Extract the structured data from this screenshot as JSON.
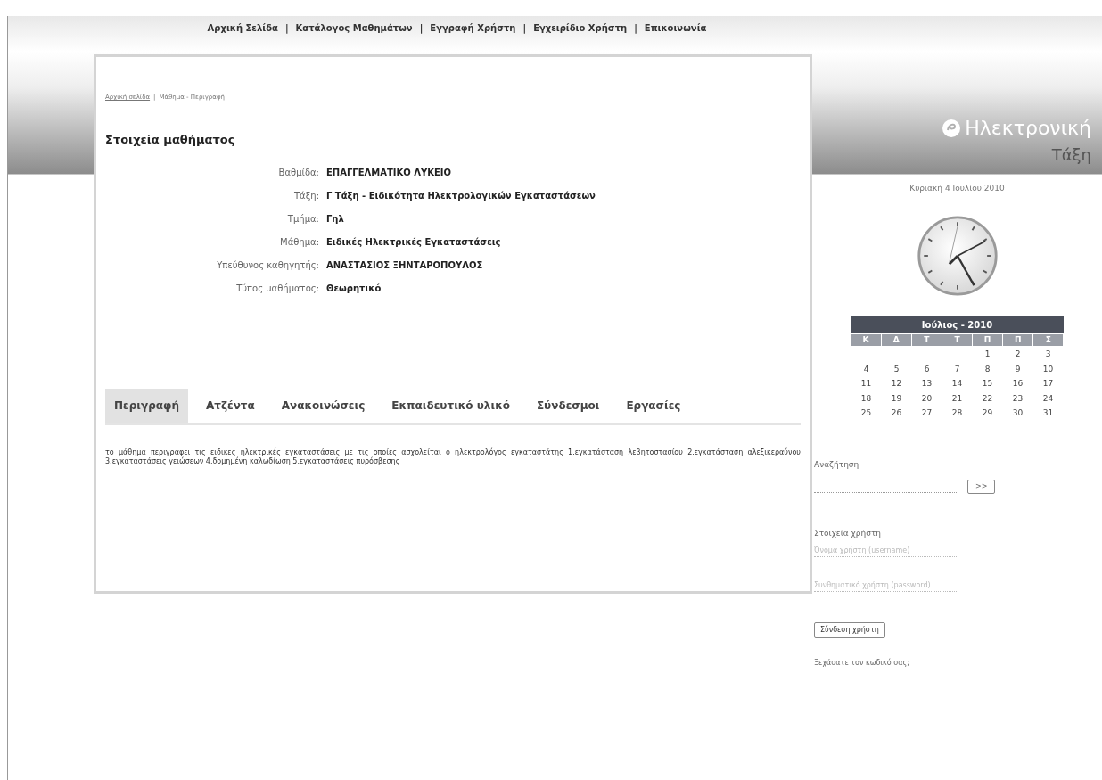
{
  "nav": [
    "Αρχική Σελίδα",
    "Κατάλογος Μαθημάτων",
    "Εγγραφή Χρήστη",
    "Εγχειρίδιο Χρήστη",
    "Επικοινωνία"
  ],
  "nav_separator": "|",
  "breadcrumb": {
    "link": "Αρχική σελίδα",
    "separator": "|",
    "current": "Μάθημα - Περιγραφή"
  },
  "course": {
    "title": "Στοιχεία μαθήματος",
    "fields": [
      {
        "label": "Βαθμίδα:",
        "value": "ΕΠΑΓΓΕΛΜΑΤΙΚΟ ΛΥΚΕΙΟ"
      },
      {
        "label": "Τάξη:",
        "value": "Γ Τάξη - Ειδικότητα Ηλεκτρολογικών Εγκαταστάσεων"
      },
      {
        "label": "Τμήμα:",
        "value": "Γηλ"
      },
      {
        "label": "Μάθημα:",
        "value": "Ειδικές Ηλεκτρικές Εγκαταστάσεις"
      },
      {
        "label": "Υπεύθυνος καθηγητής:",
        "value": "ΑΝΑΣΤΑΣΙΟΣ ΞΗΝΤΑΡΟΠΟΥΛΟΣ"
      },
      {
        "label": "Τύπος μαθήματος:",
        "value": "Θεωρητικό"
      }
    ]
  },
  "tabs": [
    {
      "label": "Περιγραφή",
      "selected": true
    },
    {
      "label": "Ατζέντα",
      "selected": false
    },
    {
      "label": "Ανακοινώσεις",
      "selected": false
    },
    {
      "label": "Εκπαιδευτικό υλικό",
      "selected": false
    },
    {
      "label": "Σύνδεσμοι",
      "selected": false
    },
    {
      "label": "Εργασίες",
      "selected": false
    }
  ],
  "description": "το μάθημα περιγραφει τις ειδικες ηλεκτρικές εγκαταστάσεις με τις οποίες ασχολείται ο ηλεκτρολόγος εγκαταστάτης 1.εγκατάσταση λεβητοστασίου 2.εγκατάσταση αλεξικεραύνου 3.εγκαταστάσεις γειώσεων 4.δομημένη καλωδίωση 5.εγκαταστάσεις πυρόσβεσης",
  "logo": {
    "line1": "Ηλεκτρονική",
    "line2": "Τάξη"
  },
  "date": "Κυριακή 4 Ιουλίου 2010",
  "calendar": {
    "title": "Ιούλιος - 2010",
    "weekdays": [
      "Κ",
      "Δ",
      "Τ",
      "Τ",
      "Π",
      "Π",
      "Σ"
    ],
    "weeks": [
      {
        "kind": "ends_at_saturday",
        "days": [
          "1",
          "2",
          "3"
        ]
      },
      {
        "kind": "full",
        "days": [
          "4",
          "5",
          "6",
          "7",
          "8",
          "9",
          "10"
        ]
      },
      {
        "kind": "full",
        "days": [
          "11",
          "12",
          "13",
          "14",
          "15",
          "16",
          "17"
        ]
      },
      {
        "kind": "full",
        "days": [
          "18",
          "19",
          "20",
          "21",
          "22",
          "23",
          "24"
        ]
      },
      {
        "kind": "full",
        "days": [
          "25",
          "26",
          "27",
          "28",
          "29",
          "30",
          "31"
        ]
      }
    ]
  },
  "search": {
    "label": "Αναζήτηση",
    "button": ">>"
  },
  "user": {
    "title": "Στοιχεία χρήστη",
    "username_placeholder": "Όνομα χρήστη (username)",
    "password_placeholder": "Συνθηματικό χρήστη (password)",
    "login_button": "Σύνδεση χρήστη",
    "forgot": "Ξεχάσατε τον κωδικό σας;"
  }
}
